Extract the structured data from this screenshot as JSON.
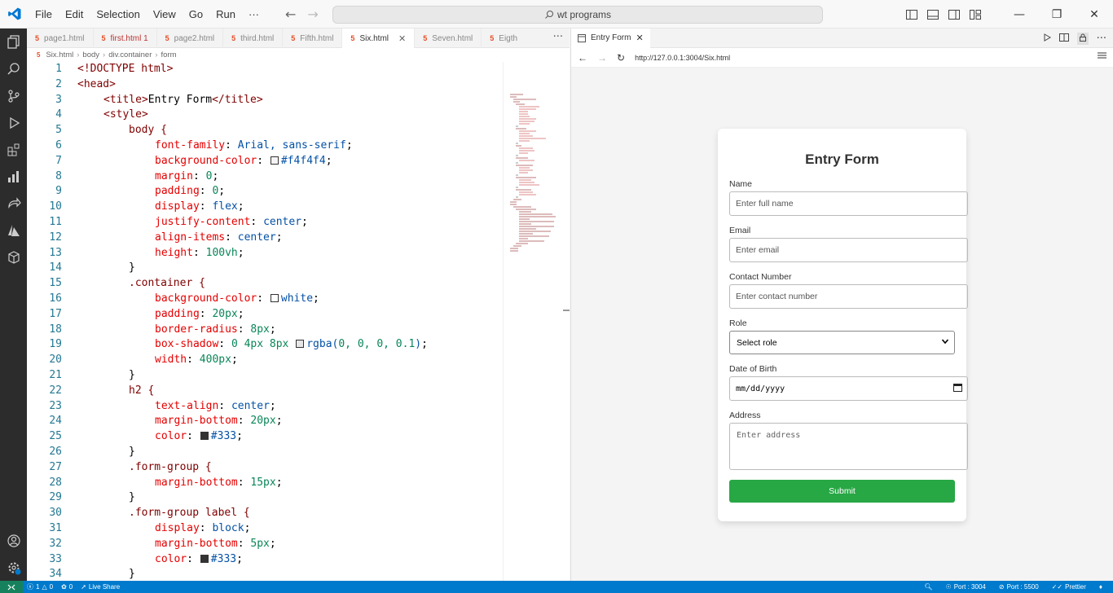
{
  "app": {
    "menu": [
      "File",
      "Edit",
      "Selection",
      "View",
      "Go",
      "Run",
      "···"
    ],
    "search_text": "wt programs",
    "accent": "#007acc"
  },
  "tabs": [
    {
      "label": "page1.html",
      "state": "normal"
    },
    {
      "label": "first.html 1",
      "state": "modified"
    },
    {
      "label": "page2.html",
      "state": "normal"
    },
    {
      "label": "third.html",
      "state": "normal"
    },
    {
      "label": "Fifth.html",
      "state": "normal"
    },
    {
      "label": "Six.html",
      "state": "active"
    },
    {
      "label": "Seven.html",
      "state": "normal"
    },
    {
      "label": "Eigth",
      "state": "normal"
    }
  ],
  "tabs_more": "···",
  "breadcrumb": [
    "Six.html",
    "body",
    "div.container",
    "form"
  ],
  "code_lines": [
    "1",
    "2",
    "3",
    "4",
    "5",
    "6",
    "7",
    "8",
    "9",
    "10",
    "11",
    "12",
    "13",
    "14",
    "15",
    "16",
    "17",
    "18",
    "19",
    "20",
    "21",
    "22",
    "23",
    "24",
    "25",
    "26",
    "27",
    "28",
    "29",
    "30",
    "31",
    "32",
    "33",
    "34"
  ],
  "code": {
    "l1": "<!DOCTYPE html>",
    "l2": "<head>",
    "l3_open": "<title>",
    "l3_text": "Entry Form",
    "l3_close": "</title>",
    "l4": "<style>",
    "l5": "body {",
    "l6_p": "font-family",
    "l6_v": "Arial, sans-serif",
    "l7_p": "background-color",
    "l7_v": "#f4f4f4",
    "l8_p": "margin",
    "l8_v": "0",
    "l9_p": "padding",
    "l9_v": "0",
    "l10_p": "display",
    "l10_v": "flex",
    "l11_p": "justify-content",
    "l11_v": "center",
    "l12_p": "align-items",
    "l12_v": "center",
    "l13_p": "height",
    "l13_v": "100vh",
    "l14": "}",
    "l15": ".container {",
    "l16_p": "background-color",
    "l16_v": "white",
    "l17_p": "padding",
    "l17_v": "20px",
    "l18_p": "border-radius",
    "l18_v": "8px",
    "l19_p": "box-shadow",
    "l19_v1": "0 4px 8px",
    "l19_v2": "rgba(",
    "l19_v3": "0, 0, 0, 0.1",
    "l19_v4": ")",
    "l20_p": "width",
    "l20_v": "400px",
    "l21": "}",
    "l22": "h2 {",
    "l23_p": "text-align",
    "l23_v": "center",
    "l24_p": "margin-bottom",
    "l24_v": "20px",
    "l25_p": "color",
    "l25_v": "#333",
    "l26": "}",
    "l27": ".form-group {",
    "l28_p": "margin-bottom",
    "l28_v": "15px",
    "l29": "}",
    "l30": ".form-group label {",
    "l31_p": "display",
    "l31_v": "block",
    "l32_p": "margin-bottom",
    "l32_v": "5px",
    "l33_p": "color",
    "l33_v": "#333",
    "l34": "}"
  },
  "preview": {
    "tab_label": "Entry Form",
    "url": "http://127.0.0.1:3004/Six.html",
    "form": {
      "title": "Entry Form",
      "name_label": "Name",
      "name_placeholder": "Enter full name",
      "email_label": "Email",
      "email_placeholder": "Enter email",
      "contact_label": "Contact Number",
      "contact_placeholder": "Enter contact number",
      "role_label": "Role",
      "role_selected": "Select role",
      "dob_label": "Date of Birth",
      "dob_placeholder": "mm/dd/yyyy",
      "address_label": "Address",
      "address_placeholder": "Enter address",
      "submit_label": "Submit",
      "submit_color": "#28a745"
    }
  },
  "status": {
    "errors": "1",
    "warnings": "0",
    "ports": "0",
    "live_share": "Live Share",
    "port_label": "Port : 3004",
    "port2_label": "Port : 5500",
    "prettier": "Prettier"
  }
}
